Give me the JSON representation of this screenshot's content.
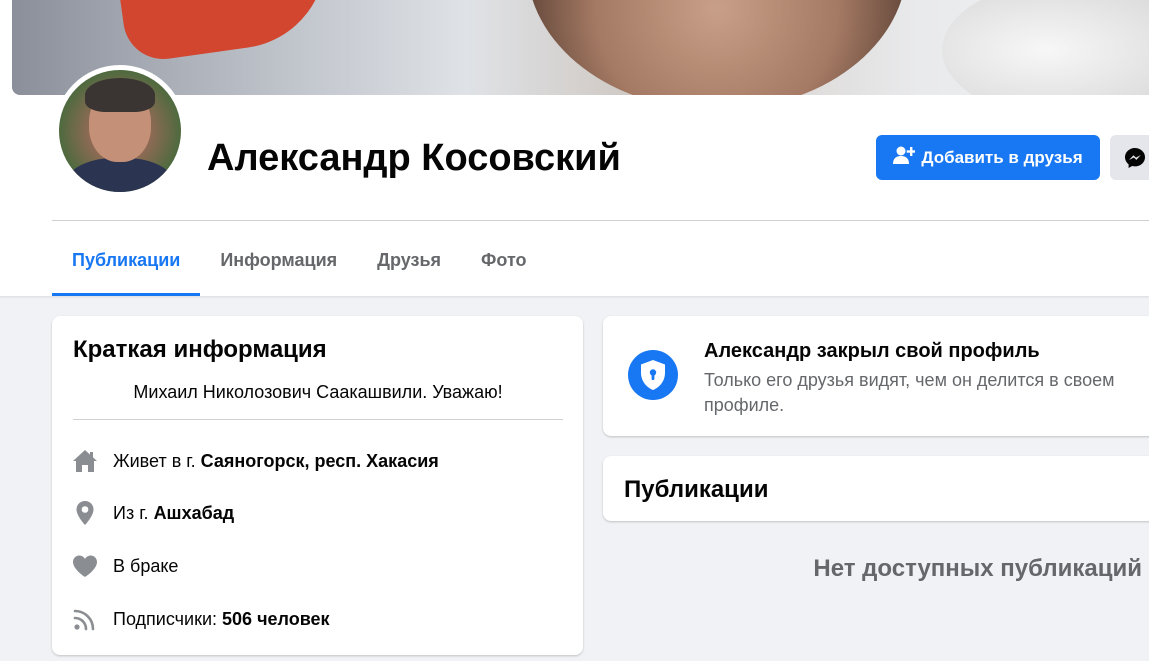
{
  "profile": {
    "name": "Александр Косовский",
    "add_friend_label": "Добавить в друзья"
  },
  "tabs": [
    {
      "label": "Публикации",
      "active": true
    },
    {
      "label": "Информация",
      "active": false
    },
    {
      "label": "Друзья",
      "active": false
    },
    {
      "label": "Фото",
      "active": false
    }
  ],
  "intro": {
    "title": "Краткая информация",
    "bio": "Михаил Николозович Саакашвили. Уважаю!",
    "items": [
      {
        "icon": "home-icon",
        "prefix": "Живет в г. ",
        "value": "Саяногорск, респ. Хакасия"
      },
      {
        "icon": "location-pin-icon",
        "prefix": "Из г. ",
        "value": "Ашхабад"
      },
      {
        "icon": "heart-icon",
        "prefix": "В браке",
        "value": ""
      },
      {
        "icon": "rss-feed-icon",
        "prefix": "Подписчики: ",
        "value": "506 человек"
      }
    ]
  },
  "locked": {
    "title": "Александр закрыл свой профиль",
    "text": "Только его друзья видят, чем он делится в своем профиле."
  },
  "posts": {
    "title": "Публикации",
    "empty_text": "Нет доступных публикаций"
  },
  "colors": {
    "accent": "#1877f2",
    "secondary_text": "#65676b",
    "background": "#f0f2f5",
    "icon_gray": "#8a8d91"
  }
}
